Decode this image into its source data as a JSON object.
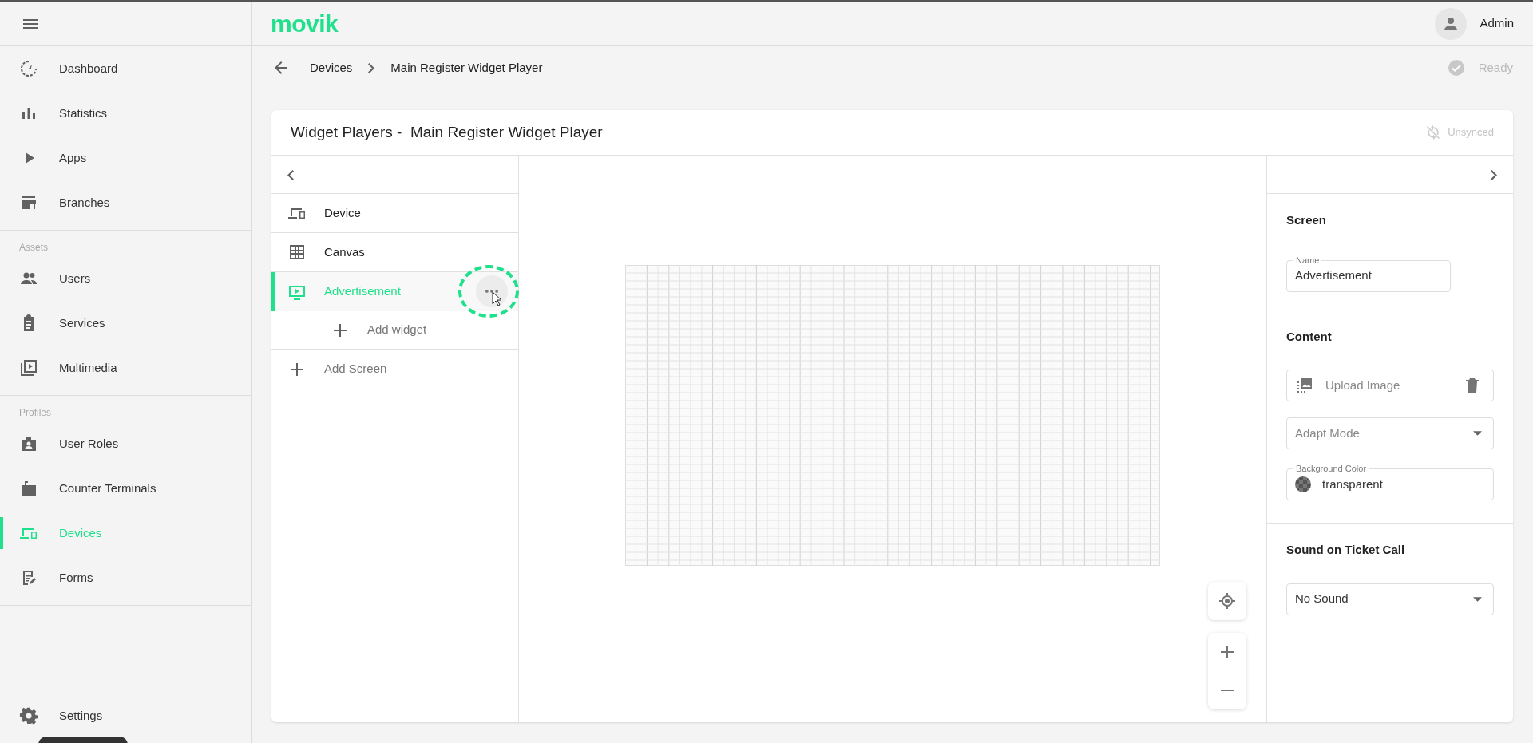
{
  "app": {
    "logo": "movik",
    "user": "Admin"
  },
  "sidebar": {
    "sections": [
      {
        "items": [
          {
            "label": "Dashboard",
            "selected": false
          },
          {
            "label": "Statistics",
            "selected": false
          },
          {
            "label": "Apps",
            "selected": false
          },
          {
            "label": "Branches",
            "selected": false
          }
        ]
      },
      {
        "label": "Assets",
        "items": [
          {
            "label": "Users",
            "selected": false
          },
          {
            "label": "Services",
            "selected": false
          },
          {
            "label": "Multimedia",
            "selected": false
          }
        ]
      },
      {
        "label": "Profiles",
        "items": [
          {
            "label": "User Roles",
            "selected": false
          },
          {
            "label": "Counter Terminals",
            "selected": false
          },
          {
            "label": "Devices",
            "selected": true
          },
          {
            "label": "Forms",
            "selected": false
          }
        ]
      }
    ],
    "footer": {
      "label": "Settings",
      "selected": false
    }
  },
  "breadcrumb": [
    "Devices",
    "Main Register Widget Player"
  ],
  "status": "Ready",
  "card": {
    "title": "Widget Players -  Main Register Widget Player",
    "sync_status": "Unsynced"
  },
  "tree": {
    "items": [
      {
        "label": "Device",
        "selected": false
      },
      {
        "label": "Canvas",
        "selected": false
      },
      {
        "label": "Advertisement",
        "selected": true,
        "add_child": "Add widget"
      }
    ],
    "add": "Add Screen"
  },
  "properties": {
    "sections": [
      {
        "title": "Screen",
        "fields": [
          {
            "kind": "text",
            "label": "Name",
            "value": "Advertisement"
          }
        ]
      },
      {
        "title": "Content",
        "fields": [
          {
            "kind": "upload",
            "placeholder": "Upload Image"
          },
          {
            "kind": "select",
            "placeholder": "Adapt Mode"
          },
          {
            "kind": "color",
            "label": "Background Color",
            "value": "transparent"
          }
        ]
      },
      {
        "title": "Sound on Ticket Call",
        "fields": [
          {
            "kind": "select",
            "value": "No Sound"
          }
        ]
      }
    ]
  }
}
